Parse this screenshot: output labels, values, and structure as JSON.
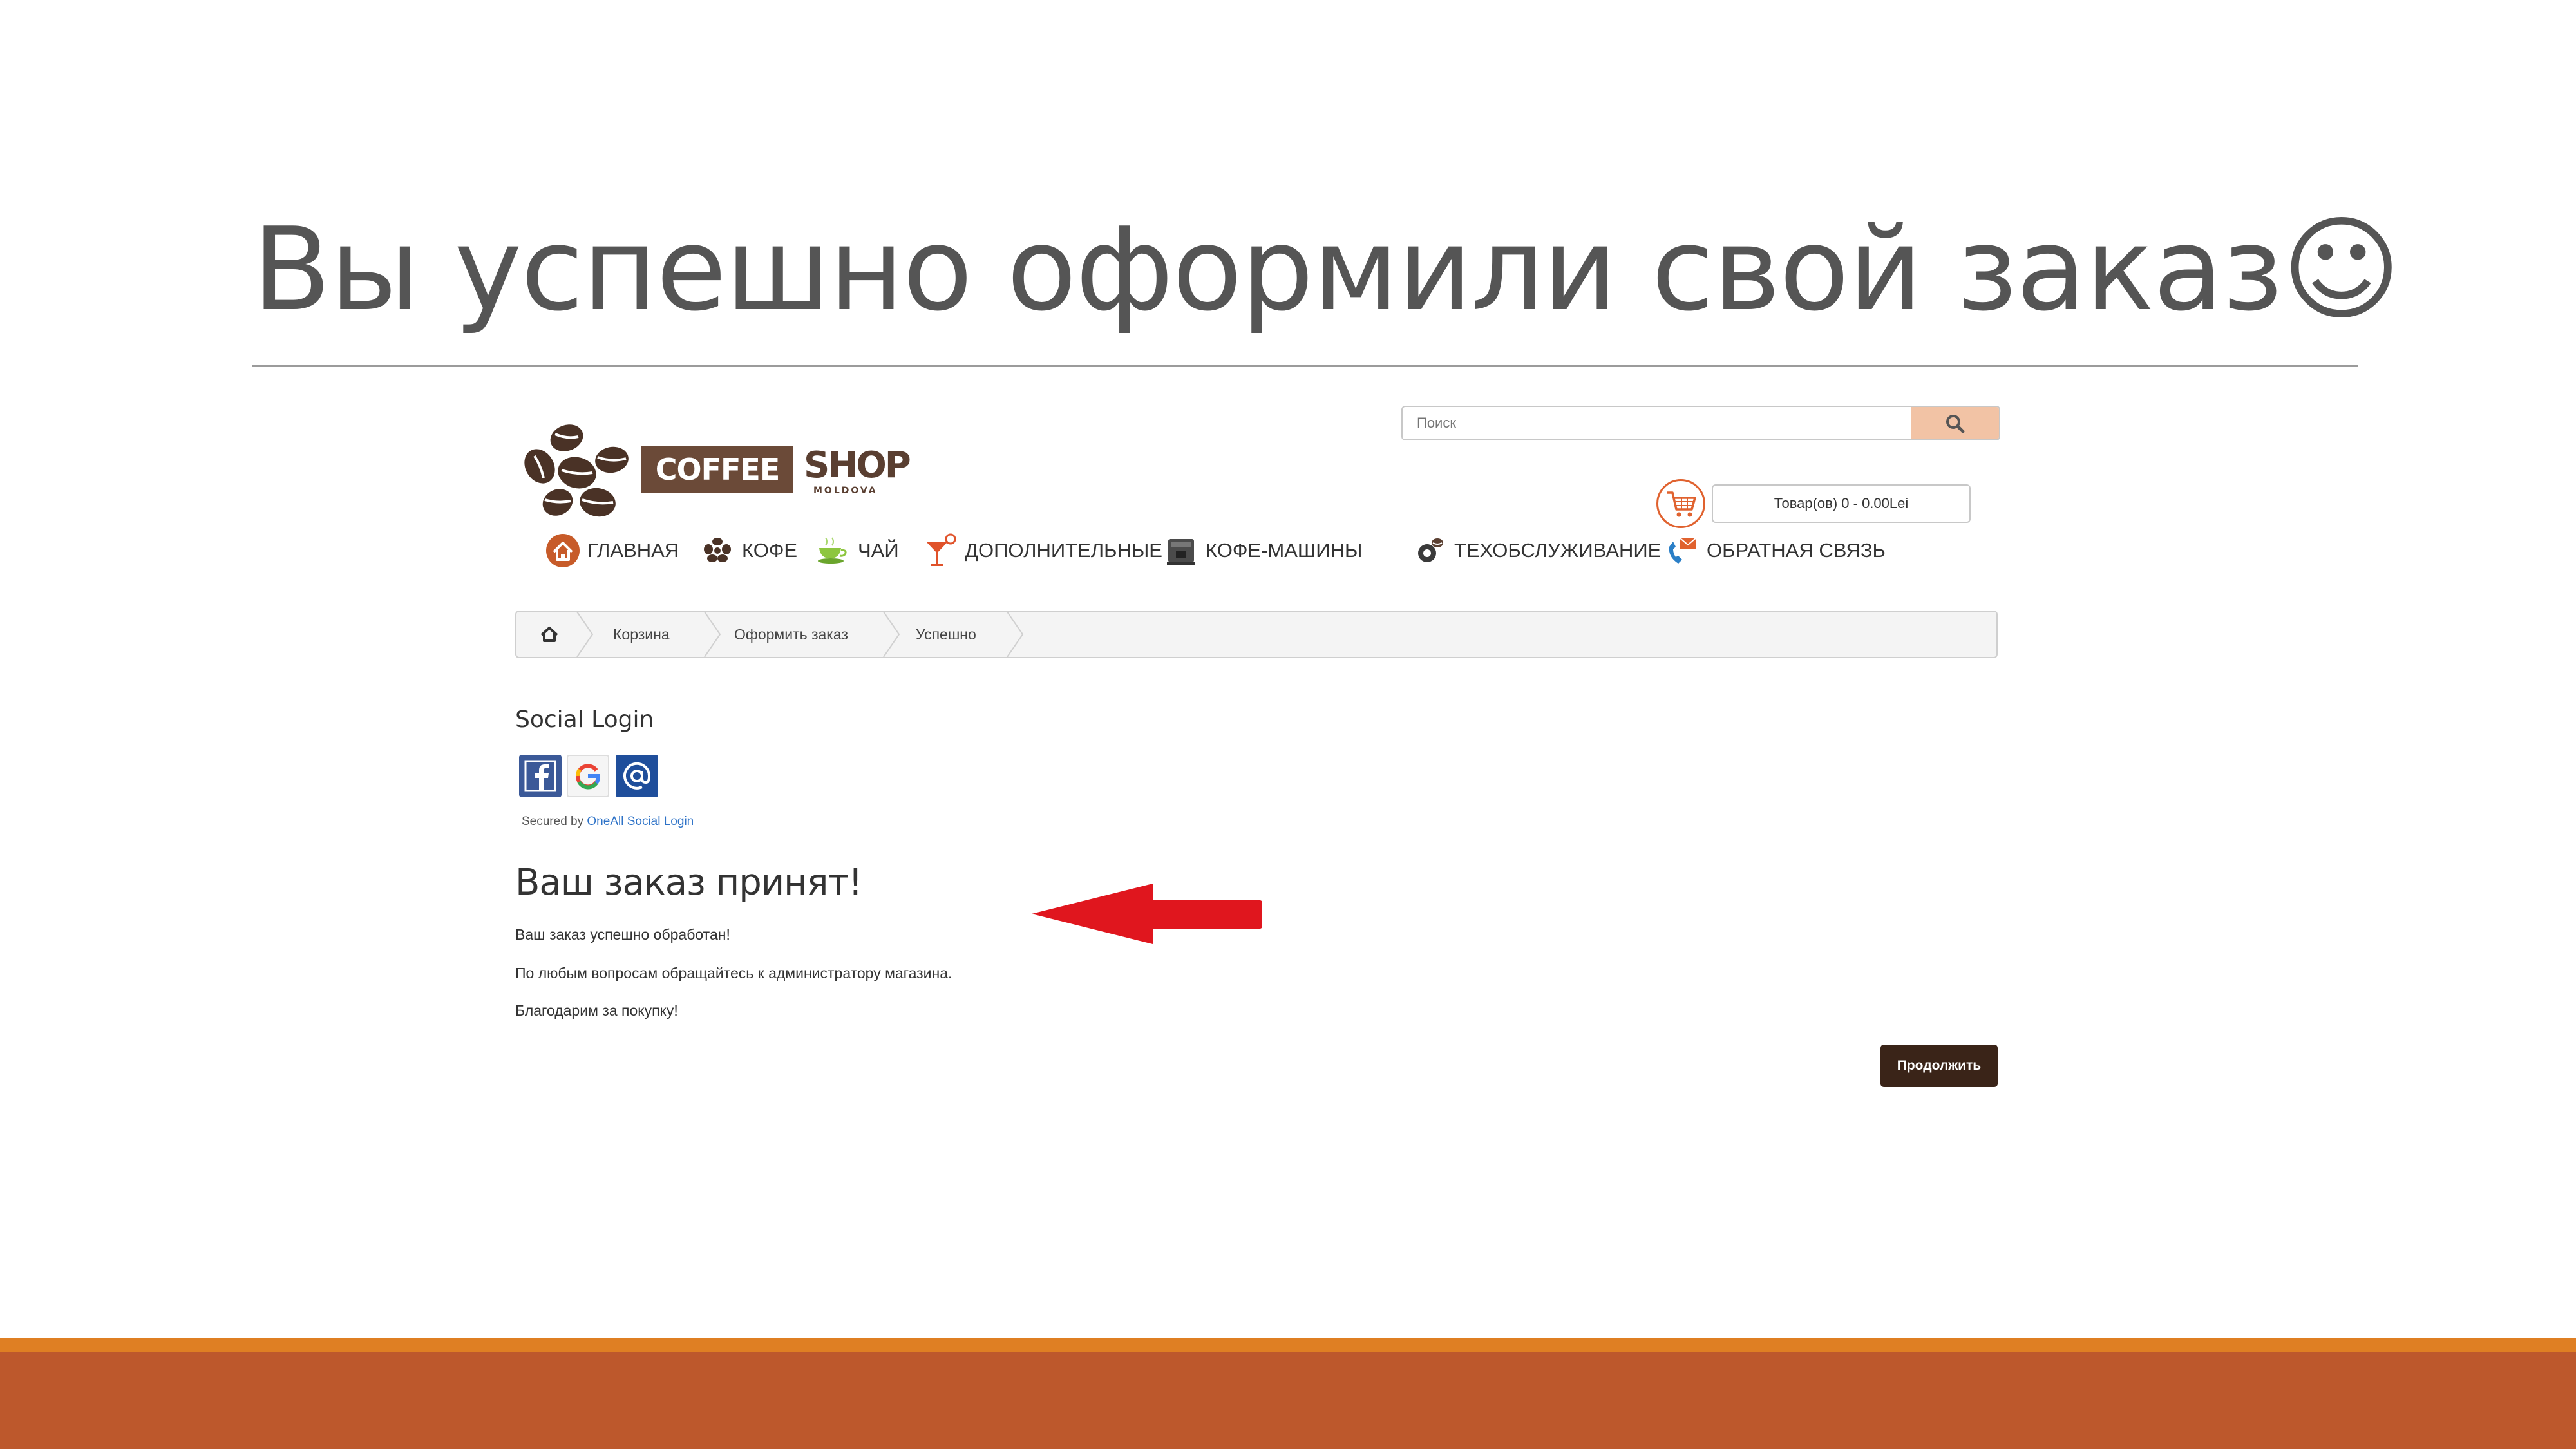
{
  "slide": {
    "title": "Вы успешно оформили свой заказ☺",
    "colors": {
      "title": "#555555",
      "band_orange": "#df7f23",
      "band_rust": "#bd582c"
    }
  },
  "site": {
    "logo": {
      "brand_left": "COFFEE",
      "brand_right": "SHOP",
      "sub": "MOLDOVA"
    },
    "search": {
      "placeholder": "Поиск",
      "icon": "search-icon"
    },
    "cart": {
      "label": "Товар(ов) 0 - 0.00Lei",
      "icon": "shopping-cart-icon"
    },
    "nav": [
      {
        "label": "ГЛАВНАЯ",
        "icon": "home-icon"
      },
      {
        "label": "КОФЕ",
        "icon": "coffee-beans-icon"
      },
      {
        "label": "ЧАЙ",
        "icon": "tea-cup-icon"
      },
      {
        "label": "ДОПОЛНИТЕЛЬНЫЕ",
        "icon": "cocktail-icon"
      },
      {
        "label": "КОФЕ-МАШИНЫ",
        "icon": "coffee-machine-icon"
      },
      {
        "label": "ТЕХОБСЛУЖИВАНИЕ",
        "icon": "service-icon"
      },
      {
        "label": "ОБРАТНАЯ СВЯЗЬ",
        "icon": "phone-envelope-icon"
      }
    ],
    "breadcrumb": [
      {
        "label": "",
        "icon": "home-icon"
      },
      {
        "label": "Корзина"
      },
      {
        "label": "Оформить заказ"
      },
      {
        "label": "Успешно"
      }
    ],
    "social": {
      "title": "Social Login",
      "providers": [
        "facebook-icon",
        "google-icon",
        "mail-at-icon"
      ],
      "secured_prefix": "Secured by ",
      "secured_link": "OneAll Social Login"
    },
    "order": {
      "title": "Ваш заказ принят!",
      "line1": "Ваш заказ успешно обработан!",
      "line2": "По любым вопросам обращайтесь к администратору магазина.",
      "line3": "Благодарим за покупку!",
      "continue_label": "Продолжить"
    }
  },
  "annotation": {
    "arrow_color": "#e0161e",
    "icon": "red-arrow-left-icon"
  }
}
